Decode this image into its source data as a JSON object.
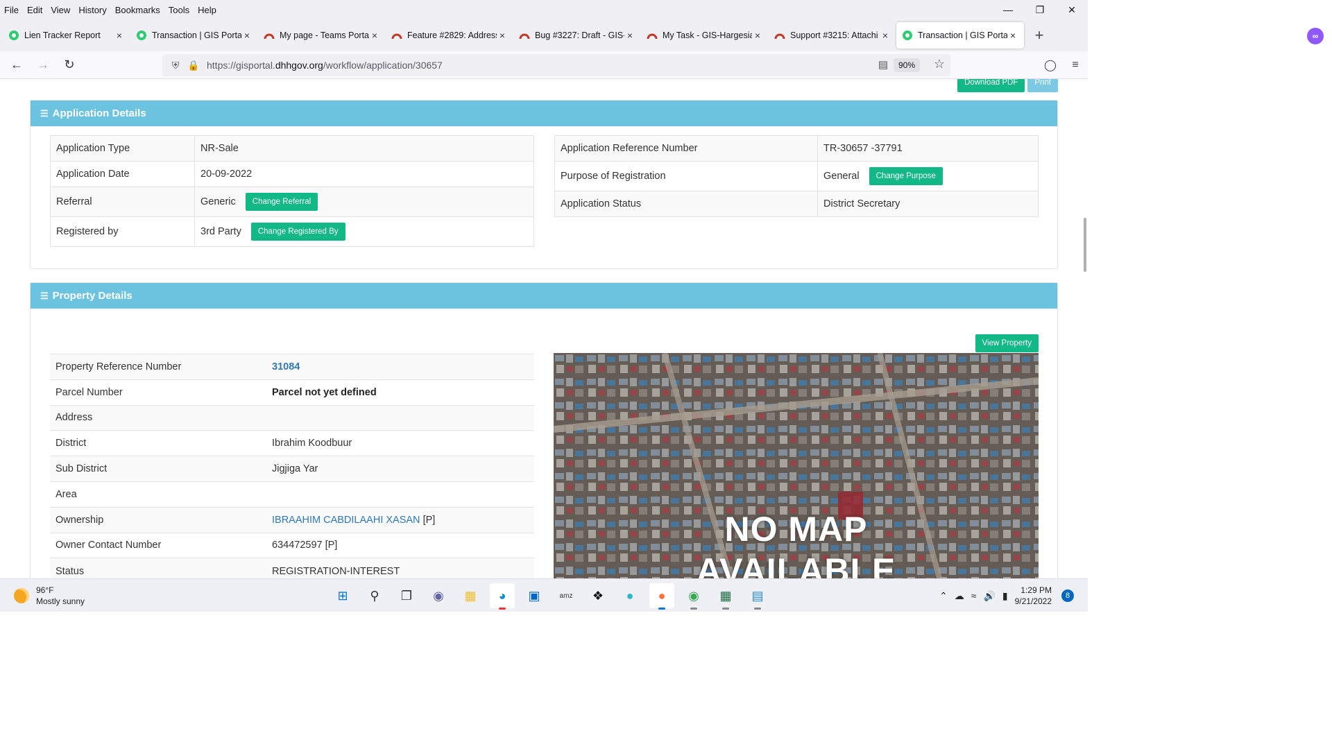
{
  "menubar": {
    "items": [
      "File",
      "Edit",
      "View",
      "History",
      "Bookmarks",
      "Tools",
      "Help"
    ]
  },
  "tabs": [
    {
      "label": "Lien Tracker Report",
      "icon": "gis-portal-icon",
      "active": false
    },
    {
      "label": "Transaction | GIS Portal",
      "icon": "gis-portal-icon",
      "active": false
    },
    {
      "label": "My page - Teams Portal",
      "icon": "redmine-icon",
      "active": false
    },
    {
      "label": "Feature #2829: Address",
      "icon": "redmine-icon",
      "active": false
    },
    {
      "label": "Bug #3227: Draft - GIS-",
      "icon": "redmine-icon",
      "active": false
    },
    {
      "label": "My Task - GIS-Hargesia",
      "icon": "redmine-icon",
      "active": false
    },
    {
      "label": "Support #3215: Attachi",
      "icon": "redmine-icon",
      "active": false
    },
    {
      "label": "Transaction | GIS Portal",
      "icon": "gis-portal-icon",
      "active": true
    }
  ],
  "navbar": {
    "url_prefix": "https://gisportal.",
    "url_domain": "dhhgov.org",
    "url_path": "/workflow/application/30657",
    "zoom": "90%"
  },
  "toolbar": {
    "download_pdf": "Download PDF",
    "print": "Print"
  },
  "application_details": {
    "title": "Application Details",
    "left_rows": [
      {
        "label": "Application Type",
        "value": "NR-Sale"
      },
      {
        "label": "Application Date",
        "value": "20-09-2022"
      },
      {
        "label": "Referral",
        "value": "Generic",
        "button": "Change Referral"
      },
      {
        "label": "Registered by",
        "value": "3rd Party",
        "button": "Change Registered By"
      }
    ],
    "right_rows": [
      {
        "label": "Application Reference Number",
        "value": "TR-30657 -37791"
      },
      {
        "label": "Purpose of Registration",
        "value": "General",
        "button": "Change Purpose"
      },
      {
        "label": "Application Status",
        "value": "District Secretary"
      }
    ]
  },
  "property_details": {
    "title": "Property Details",
    "view_property": "View Property",
    "rows": [
      {
        "label": "Property Reference Number",
        "value": "31084"
      },
      {
        "label": "Parcel Number",
        "value": "Parcel not yet defined"
      },
      {
        "label": "Address",
        "value": ""
      },
      {
        "label": "District",
        "value": "Ibrahim Koodbuur"
      },
      {
        "label": "Sub District",
        "value": "Jigjiga Yar"
      },
      {
        "label": "Area",
        "value": ""
      },
      {
        "label": "Ownership",
        "value": "IBRAAHIM CABDILAAHI XASAN",
        "suffix": "[P]"
      },
      {
        "label": "Owner Contact Number",
        "value": "634472597 [P]"
      },
      {
        "label": "Status",
        "value": "REGISTRATION-INTEREST"
      }
    ],
    "map_text_line1": "NO MAP",
    "map_text_line2": "AVAILABLE"
  },
  "taskbar": {
    "temperature": "96°F",
    "weather": "Mostly sunny",
    "time": "1:29 PM",
    "date": "9/21/2022",
    "notifications": "8"
  },
  "colors": {
    "panel_header": "#6bc3e0",
    "button_green": "#12b886",
    "link_blue": "#2f78b5"
  }
}
